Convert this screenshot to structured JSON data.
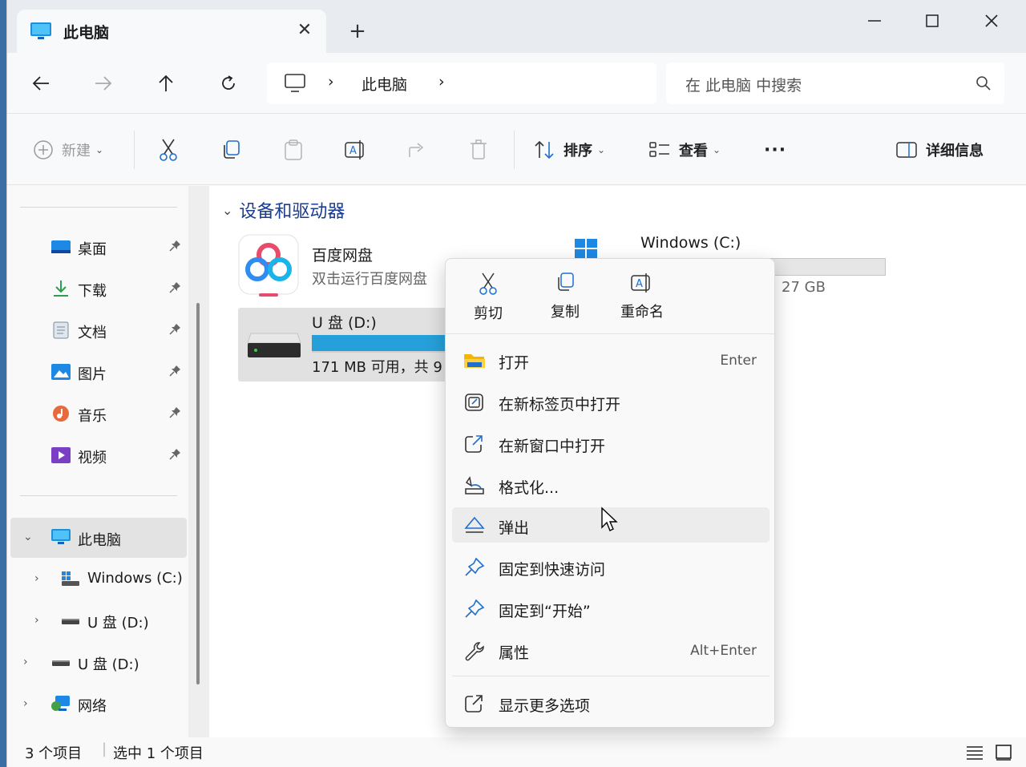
{
  "tab": {
    "title": "此电脑",
    "close": "✕",
    "new": "+"
  },
  "window_controls": {
    "minimize": "—",
    "maximize": "☐",
    "close": "✕"
  },
  "address": {
    "sep1": "›",
    "crumb": "此电脑",
    "sep2": "›"
  },
  "search": {
    "placeholder": "在 此电脑 中搜索"
  },
  "commands": {
    "new": "新建",
    "sort": "排序",
    "view": "查看",
    "more": "···",
    "details": "详细信息"
  },
  "sidebar": {
    "quick": [
      {
        "label": "桌面"
      },
      {
        "label": "下载"
      },
      {
        "label": "文档"
      },
      {
        "label": "图片"
      },
      {
        "label": "音乐"
      },
      {
        "label": "视频"
      }
    ],
    "this_pc": "此电脑",
    "windows_c": "Windows (C:)",
    "usb_d_child": "U 盘 (D:)",
    "usb_d": "U 盘 (D:)",
    "network": "网络"
  },
  "content": {
    "group": "设备和驱动器",
    "baidu": {
      "name": "百度网盘",
      "sub": "双击运行百度网盘"
    },
    "windows": {
      "name": "Windows (C:)",
      "size_fragment": "27 GB",
      "used_fraction": 0.0
    },
    "usb": {
      "name": "U 盘 (D:)",
      "free": "171 MB 可用，共 9",
      "used_fraction": 0.95
    }
  },
  "context_menu": {
    "quick": {
      "cut": "剪切",
      "copy": "复制",
      "rename": "重命名"
    },
    "items": [
      {
        "label": "打开",
        "shortcut": "Enter"
      },
      {
        "label": "在新标签页中打开"
      },
      {
        "label": "在新窗口中打开"
      },
      {
        "label": "格式化..."
      },
      {
        "label": "弹出"
      },
      {
        "label": "固定到快速访问"
      },
      {
        "label": "固定到“开始”"
      },
      {
        "label": "属性",
        "shortcut": "Alt+Enter"
      },
      {
        "label": "显示更多选项"
      }
    ]
  },
  "status": {
    "count": "3 个项目",
    "selected": "选中 1 个项目"
  },
  "colors": {
    "accent": "#26a0da",
    "header_blue": "#1a3d8f"
  }
}
